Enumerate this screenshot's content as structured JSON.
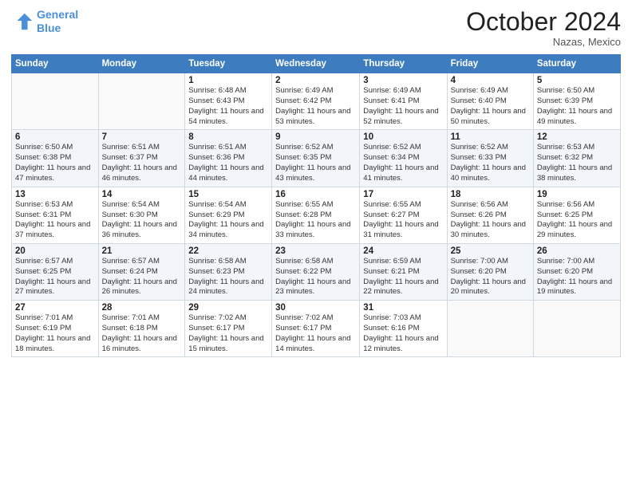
{
  "header": {
    "logo_line1": "General",
    "logo_line2": "Blue",
    "month": "October 2024",
    "location": "Nazas, Mexico"
  },
  "days_of_week": [
    "Sunday",
    "Monday",
    "Tuesday",
    "Wednesday",
    "Thursday",
    "Friday",
    "Saturday"
  ],
  "weeks": [
    [
      {
        "num": "",
        "info": ""
      },
      {
        "num": "",
        "info": ""
      },
      {
        "num": "1",
        "info": "Sunrise: 6:48 AM\nSunset: 6:43 PM\nDaylight: 11 hours and 54 minutes."
      },
      {
        "num": "2",
        "info": "Sunrise: 6:49 AM\nSunset: 6:42 PM\nDaylight: 11 hours and 53 minutes."
      },
      {
        "num": "3",
        "info": "Sunrise: 6:49 AM\nSunset: 6:41 PM\nDaylight: 11 hours and 52 minutes."
      },
      {
        "num": "4",
        "info": "Sunrise: 6:49 AM\nSunset: 6:40 PM\nDaylight: 11 hours and 50 minutes."
      },
      {
        "num": "5",
        "info": "Sunrise: 6:50 AM\nSunset: 6:39 PM\nDaylight: 11 hours and 49 minutes."
      }
    ],
    [
      {
        "num": "6",
        "info": "Sunrise: 6:50 AM\nSunset: 6:38 PM\nDaylight: 11 hours and 47 minutes."
      },
      {
        "num": "7",
        "info": "Sunrise: 6:51 AM\nSunset: 6:37 PM\nDaylight: 11 hours and 46 minutes."
      },
      {
        "num": "8",
        "info": "Sunrise: 6:51 AM\nSunset: 6:36 PM\nDaylight: 11 hours and 44 minutes."
      },
      {
        "num": "9",
        "info": "Sunrise: 6:52 AM\nSunset: 6:35 PM\nDaylight: 11 hours and 43 minutes."
      },
      {
        "num": "10",
        "info": "Sunrise: 6:52 AM\nSunset: 6:34 PM\nDaylight: 11 hours and 41 minutes."
      },
      {
        "num": "11",
        "info": "Sunrise: 6:52 AM\nSunset: 6:33 PM\nDaylight: 11 hours and 40 minutes."
      },
      {
        "num": "12",
        "info": "Sunrise: 6:53 AM\nSunset: 6:32 PM\nDaylight: 11 hours and 38 minutes."
      }
    ],
    [
      {
        "num": "13",
        "info": "Sunrise: 6:53 AM\nSunset: 6:31 PM\nDaylight: 11 hours and 37 minutes."
      },
      {
        "num": "14",
        "info": "Sunrise: 6:54 AM\nSunset: 6:30 PM\nDaylight: 11 hours and 36 minutes."
      },
      {
        "num": "15",
        "info": "Sunrise: 6:54 AM\nSunset: 6:29 PM\nDaylight: 11 hours and 34 minutes."
      },
      {
        "num": "16",
        "info": "Sunrise: 6:55 AM\nSunset: 6:28 PM\nDaylight: 11 hours and 33 minutes."
      },
      {
        "num": "17",
        "info": "Sunrise: 6:55 AM\nSunset: 6:27 PM\nDaylight: 11 hours and 31 minutes."
      },
      {
        "num": "18",
        "info": "Sunrise: 6:56 AM\nSunset: 6:26 PM\nDaylight: 11 hours and 30 minutes."
      },
      {
        "num": "19",
        "info": "Sunrise: 6:56 AM\nSunset: 6:25 PM\nDaylight: 11 hours and 29 minutes."
      }
    ],
    [
      {
        "num": "20",
        "info": "Sunrise: 6:57 AM\nSunset: 6:25 PM\nDaylight: 11 hours and 27 minutes."
      },
      {
        "num": "21",
        "info": "Sunrise: 6:57 AM\nSunset: 6:24 PM\nDaylight: 11 hours and 26 minutes."
      },
      {
        "num": "22",
        "info": "Sunrise: 6:58 AM\nSunset: 6:23 PM\nDaylight: 11 hours and 24 minutes."
      },
      {
        "num": "23",
        "info": "Sunrise: 6:58 AM\nSunset: 6:22 PM\nDaylight: 11 hours and 23 minutes."
      },
      {
        "num": "24",
        "info": "Sunrise: 6:59 AM\nSunset: 6:21 PM\nDaylight: 11 hours and 22 minutes."
      },
      {
        "num": "25",
        "info": "Sunrise: 7:00 AM\nSunset: 6:20 PM\nDaylight: 11 hours and 20 minutes."
      },
      {
        "num": "26",
        "info": "Sunrise: 7:00 AM\nSunset: 6:20 PM\nDaylight: 11 hours and 19 minutes."
      }
    ],
    [
      {
        "num": "27",
        "info": "Sunrise: 7:01 AM\nSunset: 6:19 PM\nDaylight: 11 hours and 18 minutes."
      },
      {
        "num": "28",
        "info": "Sunrise: 7:01 AM\nSunset: 6:18 PM\nDaylight: 11 hours and 16 minutes."
      },
      {
        "num": "29",
        "info": "Sunrise: 7:02 AM\nSunset: 6:17 PM\nDaylight: 11 hours and 15 minutes."
      },
      {
        "num": "30",
        "info": "Sunrise: 7:02 AM\nSunset: 6:17 PM\nDaylight: 11 hours and 14 minutes."
      },
      {
        "num": "31",
        "info": "Sunrise: 7:03 AM\nSunset: 6:16 PM\nDaylight: 11 hours and 12 minutes."
      },
      {
        "num": "",
        "info": ""
      },
      {
        "num": "",
        "info": ""
      }
    ]
  ]
}
